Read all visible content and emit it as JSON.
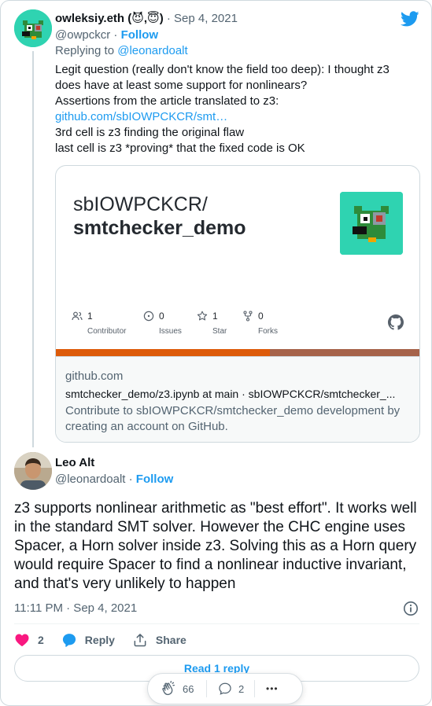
{
  "parent_tweet": {
    "name": "owleksiy.eth (😈,😇)",
    "dot": "·",
    "date": "Sep 4, 2021",
    "handle": "@owpckcr",
    "follow_label": "Follow",
    "replying_prefix": "Replying to ",
    "replying_to": "@leonardoalt",
    "text_lines": [
      "Legit question (really don't know the field too deep): I thought z3",
      "does have at least some support for nonlinears?",
      "Assertions from the article translated to z3:",
      "github.com/sbIOWPCKCR/smt…",
      "3rd cell is z3 finding the original flaw",
      "last cell is z3 *proving* that the fixed code is OK"
    ]
  },
  "card": {
    "owner": "sbIOWPCKCR/",
    "repo": "smtchecker_demo",
    "stats": [
      {
        "icon": "contributors-icon",
        "count": "1",
        "label": "Contributor"
      },
      {
        "icon": "issues-icon",
        "count": "0",
        "label": "Issues"
      },
      {
        "icon": "star-icon",
        "count": "1",
        "label": "Star"
      },
      {
        "icon": "fork-icon",
        "count": "0",
        "label": "Forks"
      }
    ],
    "domain": "github.com",
    "title": "smtchecker_demo/z3.ipynb at main · sbIOWPCKCR/smtchecker_...",
    "description": "Contribute to sbIOWPCKCR/smtchecker_demo development by creating an account on GitHub.",
    "lang_colors": [
      "#dd5b0a",
      "#a6634a"
    ]
  },
  "main_tweet": {
    "name": "Leo Alt",
    "handle": "@leonardoalt",
    "dot": "·",
    "follow_label": "Follow",
    "text": "z3 supports nonlinear arithmetic as \"best effort\". It works well in the standard SMT solver. However the CHC engine uses Spacer, a Horn solver inside z3. Solving this as a Horn query would require Spacer to find a nonlinear inductive invariant, and that's very unlikely to happen",
    "timestamp": "11:11 PM · Sep 4, 2021",
    "likes": "2",
    "reply_label": "Reply",
    "share_label": "Share",
    "read_replies_label": "Read 1 reply"
  },
  "float_bar": {
    "claps": "66",
    "comments": "2",
    "more": "•••"
  },
  "colors": {
    "accent": "#1d9bf0",
    "like": "#f91880",
    "muted": "#536471"
  }
}
